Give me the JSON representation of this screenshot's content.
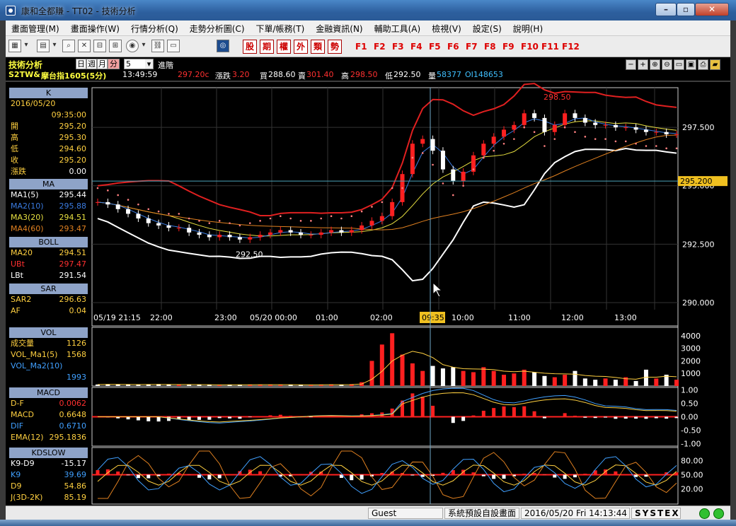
{
  "window": {
    "title": "康和全都賺 - TT02 - 技術分析",
    "minimize": "–",
    "maximize": "▫",
    "close": "✕"
  },
  "menu": [
    "畫面管理(M)",
    "畫面操作(W)",
    "行情分析(Q)",
    "走勢分析圖(C)",
    "下單/帳務(T)",
    "金融資訊(N)",
    "輔助工具(A)",
    "檢視(V)",
    "設定(S)",
    "說明(H)"
  ],
  "toolbar": {
    "red_buttons": [
      "股",
      "期",
      "權",
      "外",
      "類",
      "勢"
    ],
    "fkeys": [
      "F1",
      "F2",
      "F3",
      "F4",
      "F5",
      "F6",
      "F7",
      "F8",
      "F9",
      "F10",
      "F11",
      "F12"
    ]
  },
  "info": {
    "panel_title": "技術分析",
    "period_day": "日",
    "period_week": "週",
    "period_month": "月",
    "period_min": "分",
    "period_value": "5",
    "step": "進階",
    "symbol": "S2TW&",
    "name": "摩台指1605(5分)",
    "time": "13:49:59",
    "price": "297.20c",
    "change_label": "漲跌",
    "change": "3.20",
    "bid_label": "買",
    "bid": "288.60",
    "ask_label": "賣",
    "ask": "301.40",
    "high_label": "高",
    "high": "298.50",
    "low_label": "低",
    "low": "292.50",
    "vol_label": "量",
    "vol": "58377",
    "oi": "OI148653"
  },
  "k_panel": {
    "header": "K",
    "date": "2016/05/20",
    "time": "09:35:00",
    "rows": [
      {
        "l": "開",
        "v": "295.20"
      },
      {
        "l": "高",
        "v": "295.30"
      },
      {
        "l": "低",
        "v": "294.60"
      },
      {
        "l": "收",
        "v": "295.20"
      },
      {
        "l": "漲跌",
        "v": "0.00"
      }
    ]
  },
  "ma_panel": {
    "header": "MA",
    "rows": [
      {
        "l": "MA1(5)",
        "v": "295.44"
      },
      {
        "l": "MA2(10)",
        "v": "295.88"
      },
      {
        "l": "MA3(20)",
        "v": "294.51"
      },
      {
        "l": "MA4(60)",
        "v": "293.47"
      }
    ]
  },
  "boll_panel": {
    "header": "BOLL",
    "rows": [
      {
        "l": "MA20",
        "v": "294.51"
      },
      {
        "l": "UBt",
        "v": "297.47"
      },
      {
        "l": "LBt",
        "v": "291.54"
      }
    ]
  },
  "sar_panel": {
    "header": "SAR",
    "rows": [
      {
        "l": "SAR2",
        "v": "296.63"
      },
      {
        "l": "AF",
        "v": "0.04"
      }
    ]
  },
  "vol_panel": {
    "header": "VOL",
    "rows": [
      {
        "l": "成交量",
        "v": "1126"
      },
      {
        "l": "VOL_Ma1(5)",
        "v": "1568"
      },
      {
        "l": "VOL_Ma2(10)",
        "v": ""
      },
      {
        "l": "",
        "v": "1993"
      }
    ]
  },
  "macd_panel": {
    "header": "MACD",
    "rows": [
      {
        "l": "D-F",
        "v": "0.0062"
      },
      {
        "l": "MACD",
        "v": "0.6648"
      },
      {
        "l": "DIF",
        "v": "0.6710"
      },
      {
        "l": "EMA(12)",
        "v": "295.1836"
      }
    ]
  },
  "kd_panel": {
    "header": "KDSLOW",
    "rows": [
      {
        "l": "K9-D9",
        "v": "-15.17"
      },
      {
        "l": "K9",
        "v": "39.69"
      },
      {
        "l": "D9",
        "v": "54.86"
      },
      {
        "l": "J(3D-2K)",
        "v": "85.19"
      }
    ]
  },
  "price_axis": {
    "ticks": [
      "297.500",
      "295.000",
      "292.500",
      "290.000"
    ],
    "current": "295.200",
    "high_note": "298.50",
    "low_note": "292.50"
  },
  "time_axis": {
    "labels": [
      "05/19 21:15",
      "22:00",
      "23:00",
      "05/20 00:00",
      "01:00",
      "02:00",
      "09:35",
      "10:00",
      "11:00",
      "12:00",
      "13:00"
    ]
  },
  "vol_axis": [
    "4000",
    "3000",
    "2000",
    "1000"
  ],
  "macd_axis": [
    "1.00",
    "0.50",
    "0.00",
    "-0.50",
    "-1.00"
  ],
  "kd_axis": [
    "80.00",
    "50.00",
    "20.00"
  ],
  "colors": {
    "k": "#ffffff",
    "ma1": "#ffffff",
    "ma2": "#3a7be0",
    "ma3": "#e8e040",
    "ma4": "#e08020",
    "boll": "#e02020",
    "sar": "#ff8080",
    "up": "#ff2020",
    "down": "#ffffff",
    "title_blue": "#2d5f9e"
  },
  "chart_data": {
    "type": "candlestick",
    "title": "摩台指1605(5分)",
    "y_ticks": [
      297.5,
      295.0,
      292.5,
      290.0
    ],
    "ylim": [
      290.0,
      299.5
    ],
    "x_labels": [
      "05/19 21:15",
      "22:00",
      "23:00",
      "05/20 00:00",
      "01:00",
      "02:00",
      "09:35",
      "10:00",
      "11:00",
      "12:00",
      "13:00"
    ],
    "close": [
      294.3,
      294.2,
      294.0,
      293.8,
      293.6,
      293.4,
      293.3,
      293.2,
      293.2,
      293.0,
      292.9,
      292.8,
      292.9,
      292.8,
      292.7,
      292.8,
      292.9,
      293.0,
      293.1,
      293.0,
      292.9,
      292.9,
      293.0,
      293.1,
      293.0,
      293.1,
      293.3,
      293.5,
      293.7,
      294.3,
      295.5,
      296.8,
      297.0,
      296.5,
      295.7,
      295.2,
      295.6,
      296.3,
      296.8,
      297.1,
      297.4,
      297.6,
      298.1,
      297.9,
      297.3,
      297.6,
      298.1,
      297.9,
      297.7,
      297.6,
      297.6,
      297.5,
      297.5,
      297.4,
      297.3,
      297.3,
      297.2,
      297.2
    ],
    "volume": [
      120,
      150,
      130,
      110,
      100,
      140,
      160,
      120,
      90,
      100,
      110,
      90,
      80,
      100,
      110,
      120,
      100,
      90,
      100,
      110,
      90,
      80,
      100,
      130,
      110,
      150,
      300,
      2000,
      3300,
      4200,
      2500,
      1800,
      1200,
      1600,
      1400,
      1500,
      1200,
      1100,
      1500,
      1200,
      900,
      1000,
      1300,
      1100,
      800,
      700,
      900,
      1200,
      600,
      500,
      600,
      500,
      700,
      400,
      1300,
      600,
      900,
      500
    ],
    "high_label": 298.5,
    "low_label": 292.5,
    "current": 295.2
  }
}
